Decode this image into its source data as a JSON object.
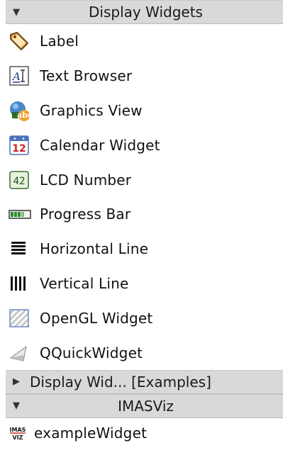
{
  "sections": [
    {
      "header": "Display Widgets",
      "expanded": true,
      "items": [
        {
          "label": "Label",
          "icon": "label-tag-icon"
        },
        {
          "label": "Text Browser",
          "icon": "text-browser-icon"
        },
        {
          "label": "Graphics View",
          "icon": "graphics-view-icon"
        },
        {
          "label": "Calendar Widget",
          "icon": "calendar-icon"
        },
        {
          "label": "LCD Number",
          "icon": "lcd-number-icon"
        },
        {
          "label": "Progress Bar",
          "icon": "progress-bar-icon"
        },
        {
          "label": "Horizontal Line",
          "icon": "horizontal-line-icon"
        },
        {
          "label": "Vertical Line",
          "icon": "vertical-line-icon"
        },
        {
          "label": "OpenGL Widget",
          "icon": "opengl-widget-icon"
        },
        {
          "label": "QQuickWidget",
          "icon": "qquickwidget-icon"
        }
      ]
    },
    {
      "header": "Display Wid... [Examples]",
      "expanded": false,
      "items": []
    },
    {
      "header": "IMASViz",
      "expanded": true,
      "items": [
        {
          "label": "exampleWidget",
          "icon": "imasviz-icon"
        }
      ]
    }
  ],
  "icon_text": {
    "calendar_day": "12",
    "lcd_digits": "42",
    "imasviz_top": "IMAS",
    "imasviz_bottom": "VIZ"
  },
  "colors": {
    "header_bg": "#d9d9d9",
    "text": "#111111"
  }
}
